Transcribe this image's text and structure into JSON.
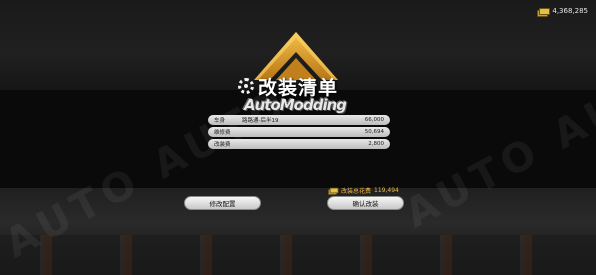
{
  "currency": {
    "amount": "4,368,285",
    "icon": "cash-icon"
  },
  "title": {
    "text": "改装清单",
    "icon": "gear-icon",
    "subtitle": "AutoModding"
  },
  "items": [
    {
      "label": "车身",
      "middle": "路路通-后半19",
      "value": "66,000"
    },
    {
      "label": "维修费",
      "middle": "",
      "value": "50,694"
    },
    {
      "label": "改装费",
      "middle": "",
      "value": "2,800"
    }
  ],
  "total": {
    "label": "改装总花费",
    "value": "119,494"
  },
  "buttons": {
    "modify": "修改配置",
    "confirm": "确认改装"
  },
  "watermark": "AUTO AUTO",
  "colors": {
    "accent": "#e0a028",
    "total": "#f0b84a"
  }
}
